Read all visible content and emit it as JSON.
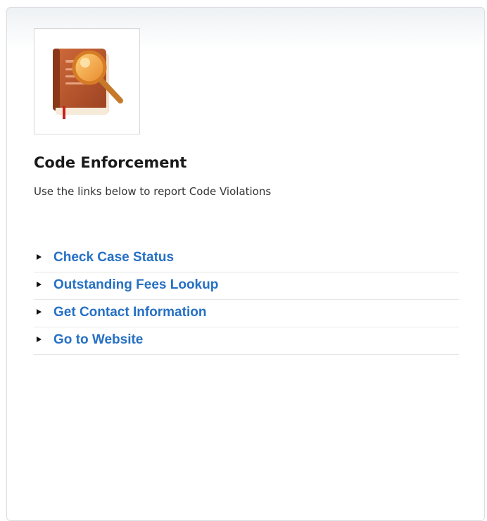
{
  "section": {
    "icon": "book-magnifier-icon",
    "title": "Code Enforcement",
    "description": "Use the links below to report Code Violations"
  },
  "links": [
    {
      "label": "Check Case Status"
    },
    {
      "label": "Outstanding Fees Lookup"
    },
    {
      "label": "Get Contact Information"
    },
    {
      "label": "Go to Website"
    }
  ],
  "colors": {
    "link": "#2670c4",
    "book": "#b5562c",
    "magnifier": "#f0a23c"
  }
}
